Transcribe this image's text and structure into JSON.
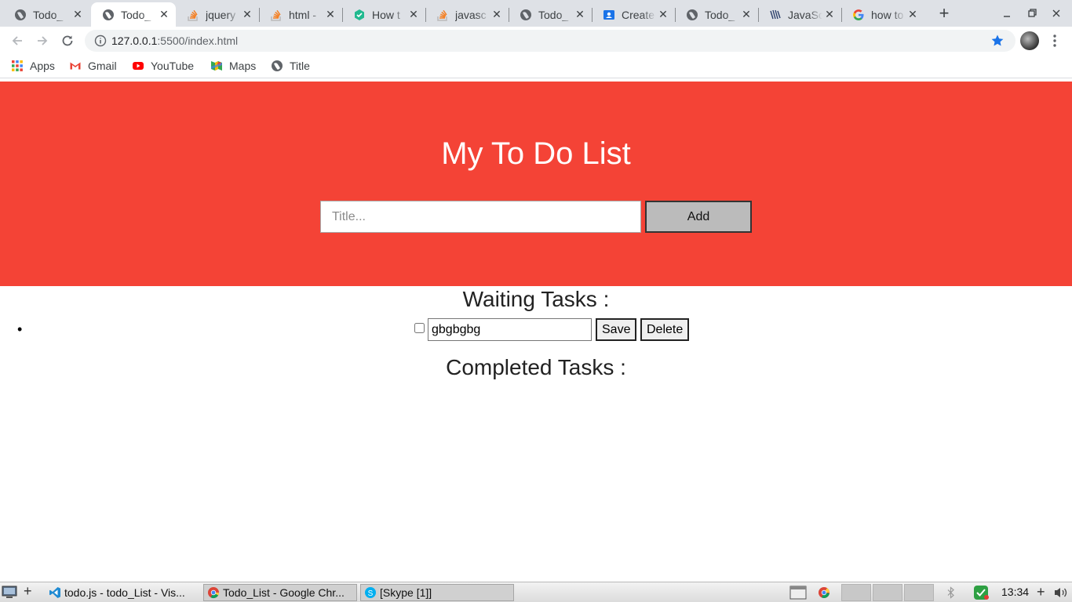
{
  "browser": {
    "tabs": [
      {
        "title": "Todo_",
        "icon": "globe-icon",
        "active": false
      },
      {
        "title": "Todo_",
        "icon": "globe-icon",
        "active": true
      },
      {
        "title": "jquery",
        "icon": "stackoverflow-icon",
        "active": false
      },
      {
        "title": "html -",
        "icon": "stackoverflow-icon",
        "active": false
      },
      {
        "title": "How t",
        "icon": "hexagon-icon",
        "active": false
      },
      {
        "title": "javasc",
        "icon": "stackoverflow-icon",
        "active": false
      },
      {
        "title": "Todo_",
        "icon": "globe-icon",
        "active": false
      },
      {
        "title": "Create",
        "icon": "contact-card-icon",
        "active": false
      },
      {
        "title": "Todo_",
        "icon": "globe-icon",
        "active": false
      },
      {
        "title": "JavaSc",
        "icon": "javascript-book-icon",
        "active": false
      },
      {
        "title": "how to",
        "icon": "google-icon",
        "active": false
      }
    ],
    "address": {
      "host": "127.0.0.1",
      "path": ":5500/index.html"
    },
    "bookmarks": [
      {
        "label": "Apps",
        "icon": "apps-grid-icon"
      },
      {
        "label": "Gmail",
        "icon": "gmail-icon"
      },
      {
        "label": "YouTube",
        "icon": "youtube-icon"
      },
      {
        "label": "Maps",
        "icon": "maps-icon"
      },
      {
        "label": "Title",
        "icon": "globe-icon"
      }
    ],
    "colors": {
      "accent_blue": "#1a73e8",
      "tab_strip": "#dee1e6"
    }
  },
  "app": {
    "title": "My To Do List",
    "title_input_placeholder": "Title...",
    "add_label": "Add",
    "waiting_title": "Waiting Tasks :",
    "completed_title": "Completed Tasks :",
    "waiting_tasks": [
      {
        "text": "gbgbgbg",
        "checked": false,
        "save_label": "Save",
        "delete_label": "Delete"
      }
    ],
    "colors": {
      "header_bg": "#f44336",
      "button_bg": "#bbbbbb"
    }
  },
  "taskbar": {
    "windows": [
      {
        "label": "todo.js - todo_List - Vis...",
        "icon": "vscode-icon"
      },
      {
        "label": "Todo_List - Google Chr...",
        "icon": "chrome-icon"
      },
      {
        "label": "[Skype [1]]",
        "icon": "skype-icon"
      }
    ],
    "clock": "13:34"
  }
}
